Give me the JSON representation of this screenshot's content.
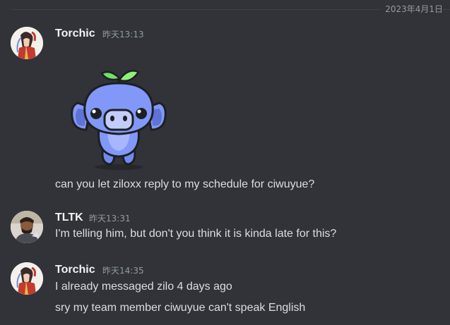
{
  "date_divider": "2023年4月1日",
  "messages": [
    {
      "author": "Torchic",
      "time": "昨天13:13",
      "avatar": "anime-character-avatar",
      "sticker": "wumpus-with-leaf-sticker",
      "lines": [
        "can you let ziloxx reply to my schedule for ciwuyue?"
      ]
    },
    {
      "author": "TLTK",
      "time": "昨天13:31",
      "avatar": "photo-person-avatar",
      "lines": [
        "I'm telling him, but don't you think it is kinda late for this?"
      ]
    },
    {
      "author": "Torchic",
      "time": "昨天14:35",
      "avatar": "anime-character-avatar",
      "lines": [
        "I already messaged zilo 4 days ago",
        "sry my team member ciwuyue can't speak English"
      ]
    }
  ],
  "colors": {
    "background": "#313338",
    "text": "#dbdee1",
    "username": "#f2f3f5",
    "muted": "#949ba4",
    "wumpus": "#8198f8"
  }
}
